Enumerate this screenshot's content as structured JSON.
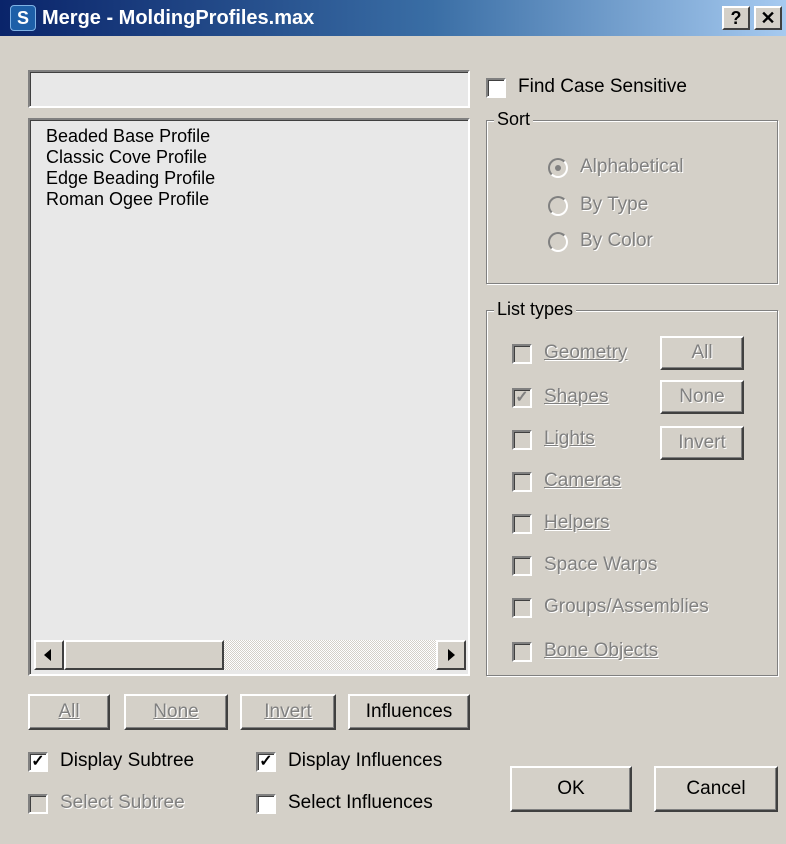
{
  "window": {
    "title": "Merge - MoldingProfiles.max",
    "app_icon": "3dsmax-s-icon",
    "help_label": "?",
    "close_label": "✕"
  },
  "search": {
    "value": "",
    "placeholder": ""
  },
  "object_list": {
    "items": [
      "Beaded Base Profile",
      "Classic Cove Profile",
      "Edge Beading Profile",
      "Roman Ogee Profile"
    ]
  },
  "select_buttons": {
    "all": "All",
    "none": "None",
    "invert": "Invert",
    "influences": "Influences"
  },
  "options": {
    "display_subtree": {
      "label": "Display Subtree",
      "checked": true
    },
    "display_influences": {
      "label": "Display Influences",
      "checked": true
    },
    "select_subtree": {
      "label": "Select Subtree",
      "checked": false
    },
    "select_influences": {
      "label": "Select Influences",
      "checked": false
    }
  },
  "find_case_sensitive": {
    "label": "Find Case Sensitive",
    "checked": false
  },
  "sort": {
    "title": "Sort",
    "options": [
      "Alphabetical",
      "By Type",
      "By Color"
    ],
    "selected": "Alphabetical"
  },
  "list_types": {
    "title": "List types",
    "items": [
      {
        "label": "Geometry",
        "checked": false
      },
      {
        "label": "Shapes",
        "checked": true
      },
      {
        "label": "Lights",
        "checked": false
      },
      {
        "label": "Cameras",
        "checked": false
      },
      {
        "label": "Helpers",
        "checked": false
      },
      {
        "label": "Space Warps",
        "checked": false
      },
      {
        "label": "Groups/Assemblies",
        "checked": false
      },
      {
        "label": "Bone Objects",
        "checked": false
      }
    ],
    "buttons": {
      "all": "All",
      "none": "None",
      "invert": "Invert"
    }
  },
  "dialog_buttons": {
    "ok": "OK",
    "cancel": "Cancel"
  },
  "colors": {
    "face": "#d4d0c8",
    "title_start": "#0a246a",
    "title_end": "#a6caf0",
    "disabled_text": "#808080"
  }
}
